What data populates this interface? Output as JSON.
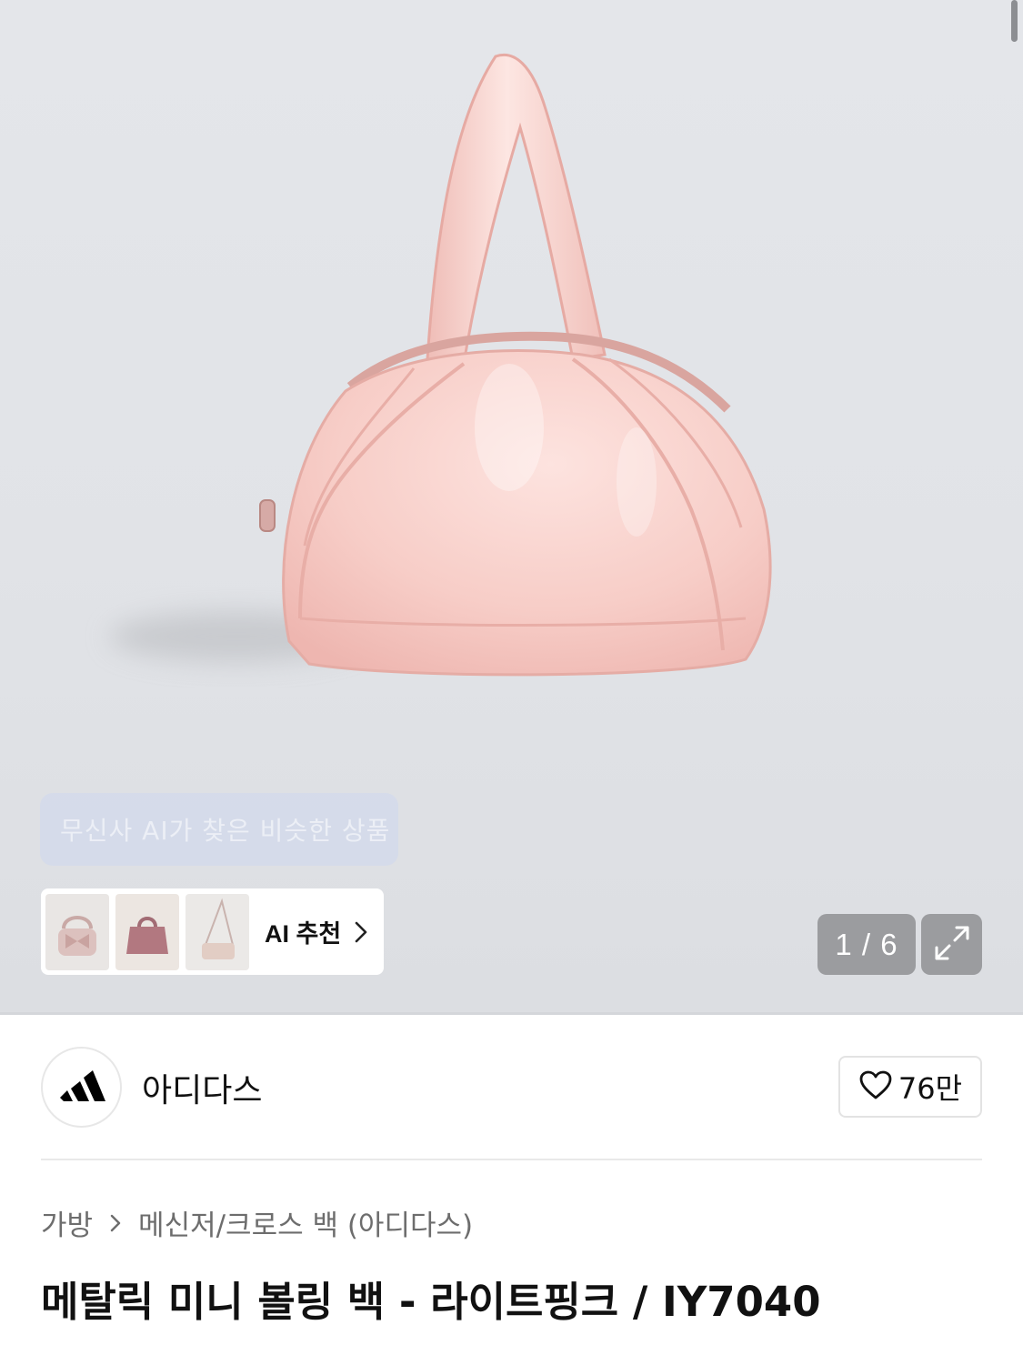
{
  "gallery": {
    "ai_banner_text": "무신사 AI가 찾은 비슷한 상품",
    "ai_card": {
      "label": "AI 추천",
      "thumbnails": [
        "bow-bag-thumbnail",
        "pink-tote-thumbnail",
        "crossbody-bag-thumbnail"
      ]
    },
    "page_counter": "1 / 6",
    "current_page": 1,
    "total_pages": 6,
    "product_color": "#f6cfc9"
  },
  "brand": {
    "name": "아디다스",
    "logo_icon": "adidas-logo-icon",
    "like_icon": "heart-icon",
    "like_count": "76만"
  },
  "breadcrumb": {
    "items": [
      "가방",
      "메신저/크로스 백 (아디다스)"
    ]
  },
  "product": {
    "title": "메탈릭 미니 볼링 백 - 라이트핑크 / IY7040"
  }
}
